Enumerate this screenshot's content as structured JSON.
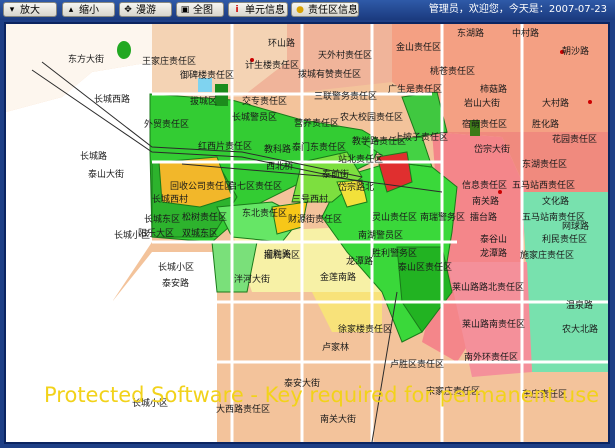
{
  "toolbar": {
    "buttons": [
      {
        "label": "放大",
        "icon": "zoom-in-icon"
      },
      {
        "label": "缩小",
        "icon": "zoom-out-icon"
      },
      {
        "label": "漫游",
        "icon": "pan-icon"
      },
      {
        "label": "全图",
        "icon": "full-extent-icon"
      },
      {
        "label": "单元信息",
        "icon": "info-icon"
      },
      {
        "label": "责任区信息",
        "icon": "zone-info-icon"
      }
    ],
    "status_text": "管理员，欢迎您，今天是：2007-07-23"
  },
  "map": {
    "labels": [
      "东方大街",
      "王家庄责任区",
      "御碑楼责任区",
      "计生楼责任区",
      "环山路",
      "天外村责任区",
      "金山责任区",
      "东湖路",
      "中村路",
      "朝沙路",
      "长城西路",
      "拔城区",
      "交专责任区",
      "拨城有赞责任区",
      "三联警务责任区",
      "广生是责任区",
      "桃苍责任区",
      "柿菇路",
      "岩山大街",
      "大村路",
      "外贸责任区",
      "长城警员区",
      "营养责任区",
      "教学路责任区",
      "农大校园责任区",
      "宿萌责任区",
      "胜化路",
      "长城路",
      "红西片责任区",
      "教科路",
      "泰门东责任区",
      "上坡子责任区",
      "花园责任区",
      "泰山大街",
      "站北责任区",
      "岱宗大街",
      "东湖责任区",
      "回收公司责任区",
      "西北桥",
      "启七区责任区",
      "泰前街",
      "信息责任区",
      "五马站西责任区",
      "长城西村",
      "三号西村",
      "岱宗路北",
      "南关路",
      "文化路",
      "长城东区",
      "松树责任区",
      "东北责任区",
      "财源街责任区",
      "灵山责任区",
      "南瑞警务区",
      "擂台路",
      "五马站南责任区",
      "长城小区",
      "网球路",
      "阳乐大区",
      "双城东区",
      "南湖警员区",
      "利民责任区",
      "擂利大区",
      "龙潭路",
      "龙潭路",
      "泰谷山",
      "胜利警务区",
      "施家庄责任区",
      "长城小区",
      "泰安路",
      "迎胜路",
      "泮河大街",
      "金莲南路",
      "泰山区责任区",
      "温泉路",
      "莱山路路北责任区",
      "农大北路",
      "莱山路南责任区",
      "徐家楼责任区",
      "卢家林",
      "南外环责任区",
      "卢胜区责任区",
      "宋家庄责任区",
      "泰安大街",
      "东庄责任区",
      "大西路责任区",
      "长城小区",
      "南关大街"
    ],
    "watermark": "Protected  Software - Key required for permanent use"
  }
}
